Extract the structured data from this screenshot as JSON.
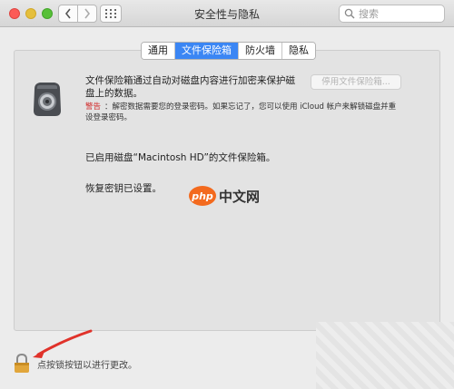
{
  "window": {
    "title": "安全性与隐私",
    "search_placeholder": "搜索"
  },
  "tabs": [
    {
      "label": "通用",
      "active": false
    },
    {
      "label": "文件保险箱",
      "active": true
    },
    {
      "label": "防火墙",
      "active": false
    },
    {
      "label": "隐私",
      "active": false
    }
  ],
  "filevault": {
    "description": "文件保险箱通过自动对磁盘内容进行加密来保护磁盘上的数据。",
    "disable_button": "停用文件保险箱...",
    "warning_label": "警告",
    "warning_text": "：解密数据需要您的登录密码。如果忘记了，您可以使用 iCloud 帐户来解锁磁盘并重设登录密码。",
    "enabled_status": "已启用磁盘“Macintosh HD”的文件保险箱。",
    "recovery_status": "恢复密钥已设置。"
  },
  "watermark": {
    "logo": "php",
    "text": "中文网"
  },
  "lock": {
    "label": "点按锁按钮以进行更改。"
  },
  "colors": {
    "tab_active": "#3b86f4",
    "warning": "#d12b2b",
    "arrow": "#e0322a"
  }
}
